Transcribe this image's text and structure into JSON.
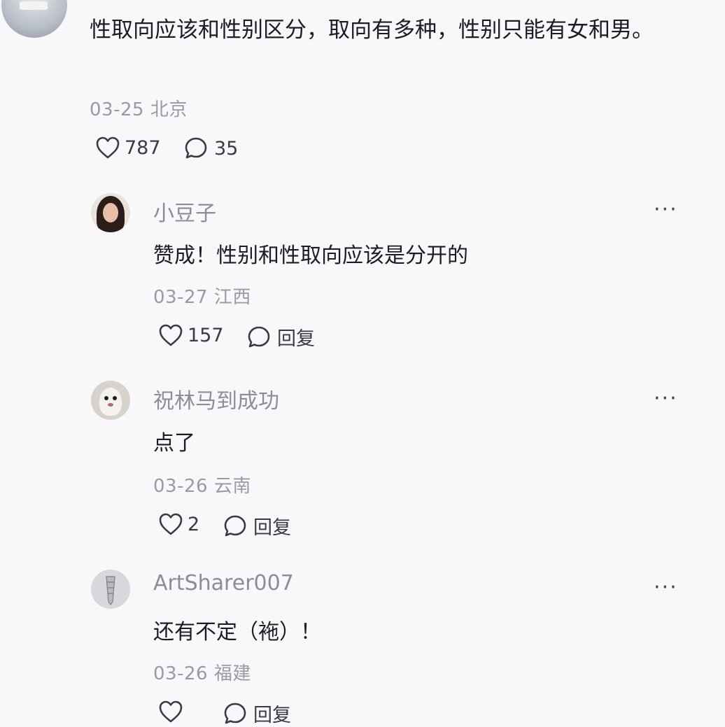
{
  "top_comment": {
    "text": "性取向应该和性别区分，取向有多种，性别只能有女和男。",
    "date": "03-25",
    "location": "北京",
    "likes": "787",
    "replies": "35"
  },
  "replies": [
    {
      "username": "小豆子",
      "text": "赞成！性别和性取向应该是分开的",
      "date": "03-27",
      "location": "江西",
      "likes": "157",
      "reply_label": "回复"
    },
    {
      "username": "祝林马到成功",
      "text": "点了",
      "date": "03-26",
      "location": "云南",
      "likes": "2",
      "reply_label": "回复"
    },
    {
      "username": "ArtSharer007",
      "text": "还有不定（袘）！",
      "date": "03-26",
      "location": "福建",
      "likes": "",
      "reply_label": "回复"
    }
  ],
  "more_label": "···",
  "colors": {
    "background": "#f8f8fb",
    "meta_gray": "#9a9aa6",
    "text": "#1c1c24"
  },
  "icons": [
    "heart-icon",
    "comment-icon",
    "more-icon"
  ]
}
